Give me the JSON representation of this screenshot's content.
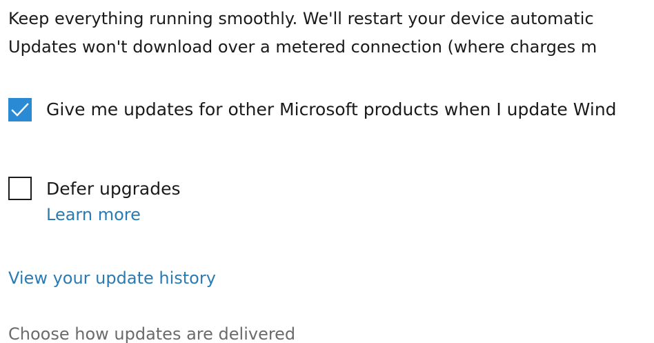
{
  "description": {
    "line1": "Keep everything running smoothly. We'll restart your device automatic",
    "line2": "Updates won't download over a metered connection (where charges m"
  },
  "options": {
    "other_products": {
      "label": "Give me updates for other Microsoft products when I update Wind",
      "checked": true
    },
    "defer_upgrades": {
      "label": "Defer upgrades",
      "checked": false,
      "learn_more": "Learn more"
    }
  },
  "links": {
    "update_history": "View your update history",
    "delivery": "Choose how updates are delivered"
  },
  "colors": {
    "accent": "#2a8ad4",
    "link": "#2a7ab3",
    "text": "#1a1a1a",
    "muted_link": "#6b6b6b"
  }
}
